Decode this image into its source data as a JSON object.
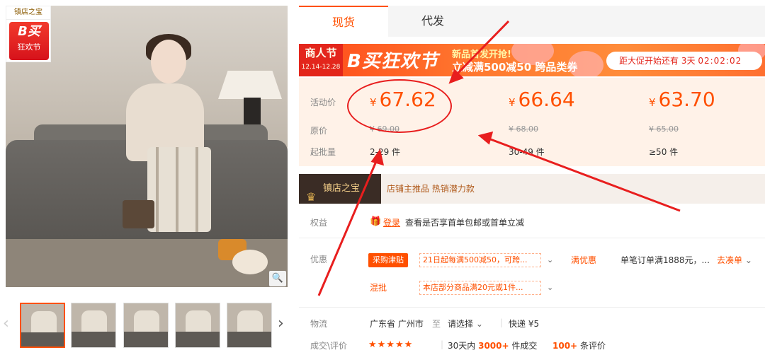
{
  "gallery": {
    "shop_badge_brand": "镇店之宝",
    "badge_line1": "B买",
    "badge_line2": "狂欢节",
    "zoom_icon": "magnifier-icon",
    "prev_icon": "chevron-left-icon",
    "next_icon": "chevron-right-icon"
  },
  "tabs": [
    {
      "label": "现货"
    },
    {
      "label": "代发"
    }
  ],
  "banner": {
    "tag_title": "商人节",
    "tag_dates": "12.14-12.28",
    "title": "B买狂欢节",
    "promo_line1": "新品首发开抢!",
    "promo_line2": "立减满500减50 跨品类券",
    "countdown_prefix": "距大促开始还有",
    "countdown_days": "3天",
    "countdown_time": "02:02:02"
  },
  "pricing": {
    "labels": {
      "price": "活动价",
      "original": "原价",
      "moq": "起批量"
    },
    "tiers": [
      {
        "price": "67.62",
        "original": "¥ 69.00",
        "moq": "2-29 件"
      },
      {
        "price": "66.64",
        "original": "¥ 68.00",
        "moq": "30-49 件"
      },
      {
        "price": "63.70",
        "original": "¥ 65.00",
        "moq": "≥50 件"
      }
    ],
    "currency": "¥"
  },
  "shop_strip": {
    "badge": "镇店之宝",
    "text": "店铺主推品  热销潜力款",
    "icon": "crown-icon"
  },
  "rights": {
    "label": "权益",
    "link": "登录",
    "text": "查看是否享首单包邮或首单立减",
    "icon": "gift-icon"
  },
  "offers": {
    "label": "优惠",
    "tag": "采购津贴",
    "coupon1": "21日起每满500减50，可跨...",
    "full_discount": "满优惠",
    "order_note": "单笔订单满1888元，...",
    "go_order": "去凑单",
    "mixed_label": "混批",
    "coupon2": "本店部分商品满20元或1件..."
  },
  "logistics": {
    "label": "物流",
    "from": "广东省 广州市",
    "to_word": "至",
    "select": "请选择",
    "express": "快递 ¥5"
  },
  "reviews": {
    "label": "成交\\评价",
    "stars": "★★★★★",
    "sold_prefix": "30天内",
    "sold_count": "3000+",
    "sold_suffix": "件成交",
    "review_count": "100+",
    "review_suffix": "条评价"
  },
  "colors": {
    "accent": "#ff5000",
    "annotation": "#e81e1e"
  }
}
